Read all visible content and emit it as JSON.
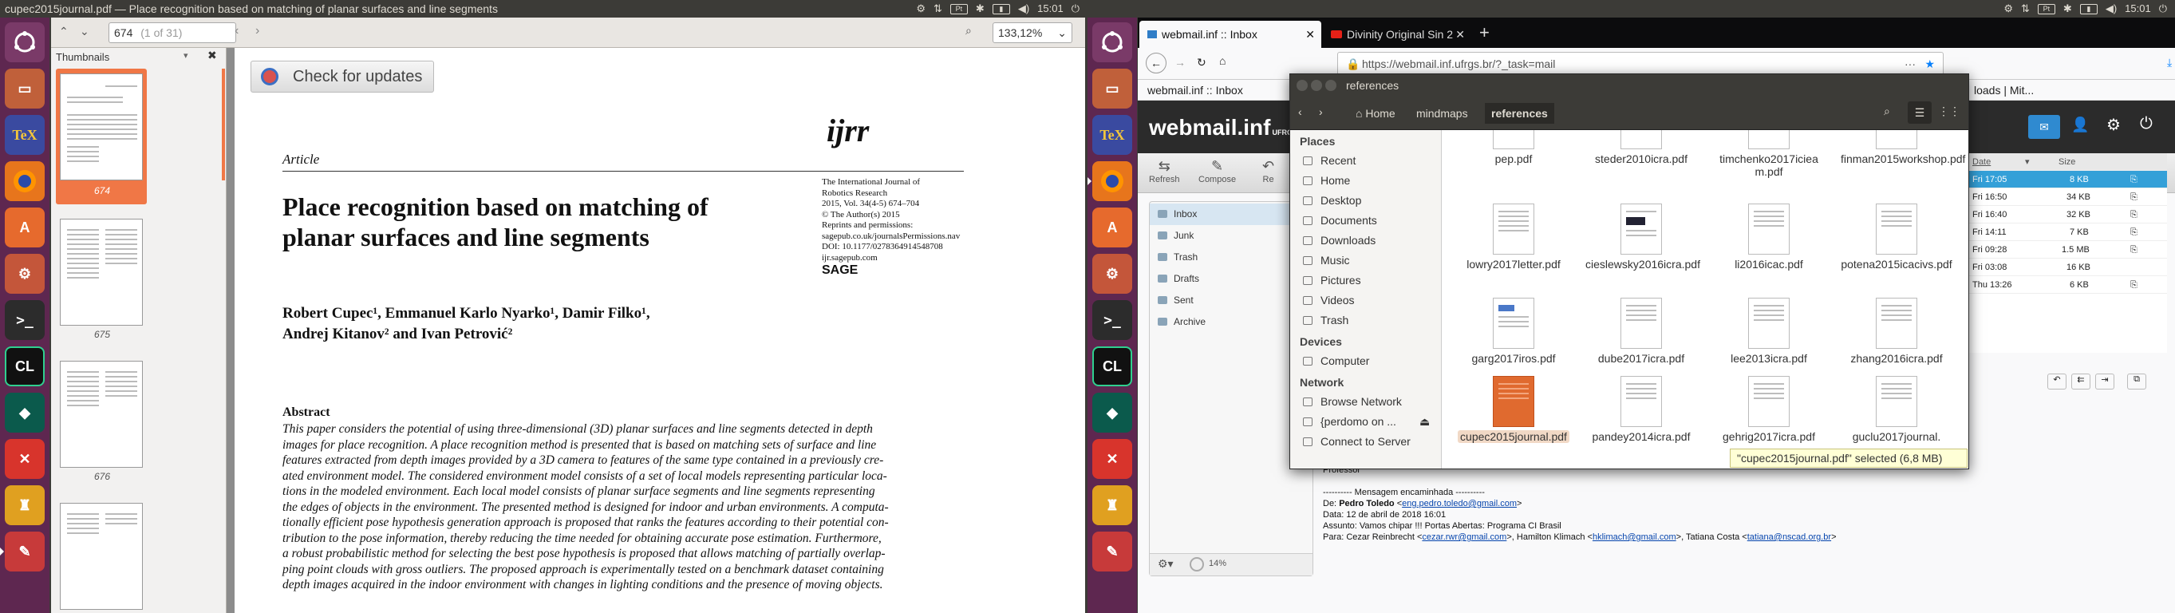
{
  "evince": {
    "window_title": "cupec2015journal.pdf — Place recognition based on matching of planar surfaces and line segments",
    "page_input": "674",
    "page_count": "(1 of 31)",
    "zoom": "133,12%",
    "sidebar_title": "Thumbnails",
    "thumb_labels": [
      "674",
      "675",
      "676"
    ],
    "update_button": "Check for updates",
    "paper": {
      "logo": "ijrr",
      "section": "Article",
      "title_line1": "Place recognition based on matching of",
      "title_line2": "planar surfaces and line segments",
      "journal_lines": [
        "The International Journal of",
        "Robotics Research",
        "2015, Vol. 34(4-5) 674–704",
        "© The Author(s) 2015",
        "Reprints and permissions:",
        "sagepub.co.uk/journalsPermissions.nav",
        "DOI: 10.1177/0278364914548708",
        "ijr.sagepub.com"
      ],
      "publisher": "SAGE",
      "authors_line1": "Robert Cupec¹, Emmanuel Karlo Nyarko¹, Damir Filko¹,",
      "authors_line2": "Andrej Kitanov² and Ivan Petrović²",
      "abstract_heading": "Abstract",
      "abstract_lines": [
        "This paper considers the potential of using three-dimensional (3D) planar surfaces and line segments detected in depth",
        "images for place recognition. A place recognition method is presented that is based on matching sets of surface and line",
        "features extracted from depth images provided by a 3D camera to features of the same type contained in a previously cre-",
        "ated environment model. The considered environment model consists of a set of local models representing particular loca-",
        "tions in the modeled environment. Each local model consists of planar surface segments and line segments representing",
        "the edges of objects in the environment. The presented method is designed for indoor and urban environments. A computa-",
        "tionally efficient pose hypothesis generation approach is proposed that ranks the features according to their potential con-",
        "tribution to the pose information, thereby reducing the time needed for obtaining accurate pose estimation. Furthermore,",
        "a robust probabilistic method for selecting the best pose hypothesis is proposed that allows matching of partially overlap-",
        "ping point clouds with gross outliers. The proposed approach is experimentally tested on a benchmark dataset containing",
        "depth images acquired in the indoor environment with changes in lighting conditions and the presence of moving objects."
      ]
    }
  },
  "system": {
    "clock_left": "15:01",
    "clock_right": "15:01"
  },
  "launcher_icons": [
    "ubuntu-logo",
    "files",
    "texmaker",
    "firefox",
    "software-center",
    "settings",
    "terminal",
    "clion",
    "gitkraken",
    "xmind",
    "jupyter",
    "evince"
  ],
  "firefox": {
    "tab1": "webmail.inf :: Inbox",
    "tab2": "Divinity Original Sin 2",
    "url": "https://webmail.inf.ufrgs.br/?_task=mail",
    "bookmarks": [
      "webmail.inf :: Inbox",
      "loads | Mit..."
    ],
    "roundcube": {
      "logo": "webmail.inf",
      "logo_sub": "UFRGS",
      "toolbar": [
        "Refresh",
        "Compose",
        "Re"
      ],
      "folders": [
        "Inbox",
        "Junk",
        "Trash",
        "Drafts",
        "Sent",
        "Archive"
      ],
      "quota": "14%",
      "list_headers": [
        "Date",
        "Size"
      ],
      "rows": [
        {
          "date": "Fri 17:05",
          "size": "8 KB"
        },
        {
          "date": "Fri 16:50",
          "size": "34 KB"
        },
        {
          "date": "Fri 16:40",
          "size": "32 KB"
        },
        {
          "date": "Fri 14:11",
          "size": "7 KB"
        },
        {
          "date": "Fri 09:28",
          "size": "1.5 MB"
        },
        {
          "date": "Fri 03:08",
          "size": "16 KB"
        },
        {
          "date": "Thu 13:26",
          "size": "6 KB"
        }
      ],
      "mail": {
        "greeting": "Professor",
        "forward": "---------- Mensagem encaminhada ----------",
        "from_label": "De: ",
        "from_name": "Pedro Toledo",
        "from_email": "eng.pedro.toledo@gmail.com",
        "date": "Data: 12 de abril de 2018 16:01",
        "subject": "Assunto: Vamos chipar !!! Portas Abertas: Programa CI Brasil",
        "to_prefix": "Para: Cezar Reinbrecht <",
        "to_email1": "cezar.rwr@gmail.com",
        "to_mid": ">, Hamilton Klimach <",
        "to_email2": "hklimach@gmail.com",
        "to_mid2": ">, Tatiana Costa <",
        "to_email3": "tatiana@nscad.org.br",
        "to_end": ">"
      }
    }
  },
  "nautilus": {
    "title": "references",
    "crumbs": [
      "Home",
      "mindmaps",
      "references"
    ],
    "places_heading": "Places",
    "places": [
      "Recent",
      "Home",
      "Desktop",
      "Documents",
      "Downloads",
      "Music",
      "Pictures",
      "Videos",
      "Trash"
    ],
    "devices_heading": "Devices",
    "devices": [
      "Computer"
    ],
    "network_heading": "Network",
    "network": [
      "Browse Network",
      "{perdomo on ...",
      "Connect to Server"
    ],
    "files": [
      {
        "name": "pep.pdf"
      },
      {
        "name": "steder2010icra.pdf"
      },
      {
        "name": "timchenko2017iciea m.pdf"
      },
      {
        "name": "finman2015workshop.pdf"
      },
      {
        "name": "lowry2017letter.pdf"
      },
      {
        "name": "cieslewsky2016icra.pdf"
      },
      {
        "name": "li2016icac.pdf"
      },
      {
        "name": "potena2015icacivs.pdf"
      },
      {
        "name": "garg2017iros.pdf"
      },
      {
        "name": "dube2017icra.pdf"
      },
      {
        "name": "lee2013icra.pdf"
      },
      {
        "name": "zhang2016icra.pdf"
      },
      {
        "name": "cupec2015journal.pdf"
      },
      {
        "name": "pandey2014icra.pdf"
      },
      {
        "name": "gehrig2017icra.pdf"
      },
      {
        "name": "guclu2017journal."
      }
    ],
    "status": "\"cupec2015journal.pdf\" selected (6,8 MB)"
  }
}
